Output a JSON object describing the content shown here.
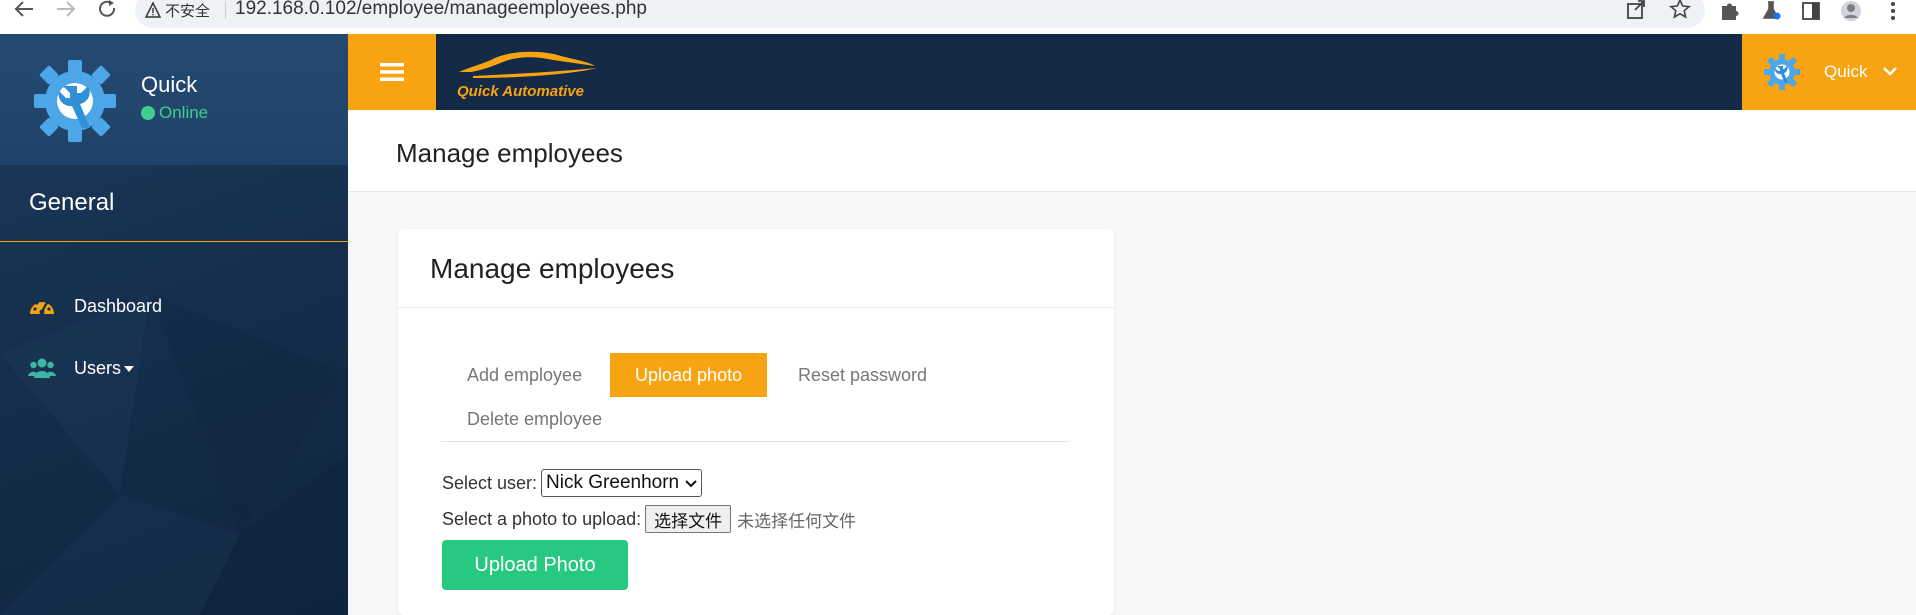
{
  "browser": {
    "security_label": "不安全",
    "url": "192.168.0.102/employee/manageemployees.php"
  },
  "sidebar": {
    "profile": {
      "name": "Quick",
      "status": "Online"
    },
    "section_title": "General",
    "items": [
      {
        "label": "Dashboard",
        "icon": "dashboard-gauge-icon"
      },
      {
        "label": "Users",
        "icon": "users-group-icon"
      }
    ]
  },
  "header": {
    "brand": "Quick Automative",
    "user_name": "Quick"
  },
  "page": {
    "title": "Manage employees"
  },
  "card": {
    "title": "Manage employees",
    "tabs": [
      {
        "label": "Add employee",
        "active": false
      },
      {
        "label": "Upload photo",
        "active": true
      },
      {
        "label": "Reset password",
        "active": false
      },
      {
        "label": "Delete employee",
        "active": false
      }
    ],
    "select_user_label": "Select user:",
    "selected_user": "Nick Greenhorn",
    "photo_label": "Select a photo to upload:",
    "file_button_label": "选择文件",
    "file_status": "未选择任何文件",
    "upload_button_label": "Upload Photo"
  },
  "colors": {
    "accent": "#f8a412",
    "sidebar_bg": "#16304f",
    "topbar_bg": "#142a46",
    "online": "#3fcf8e",
    "upload_button": "#27c981"
  }
}
